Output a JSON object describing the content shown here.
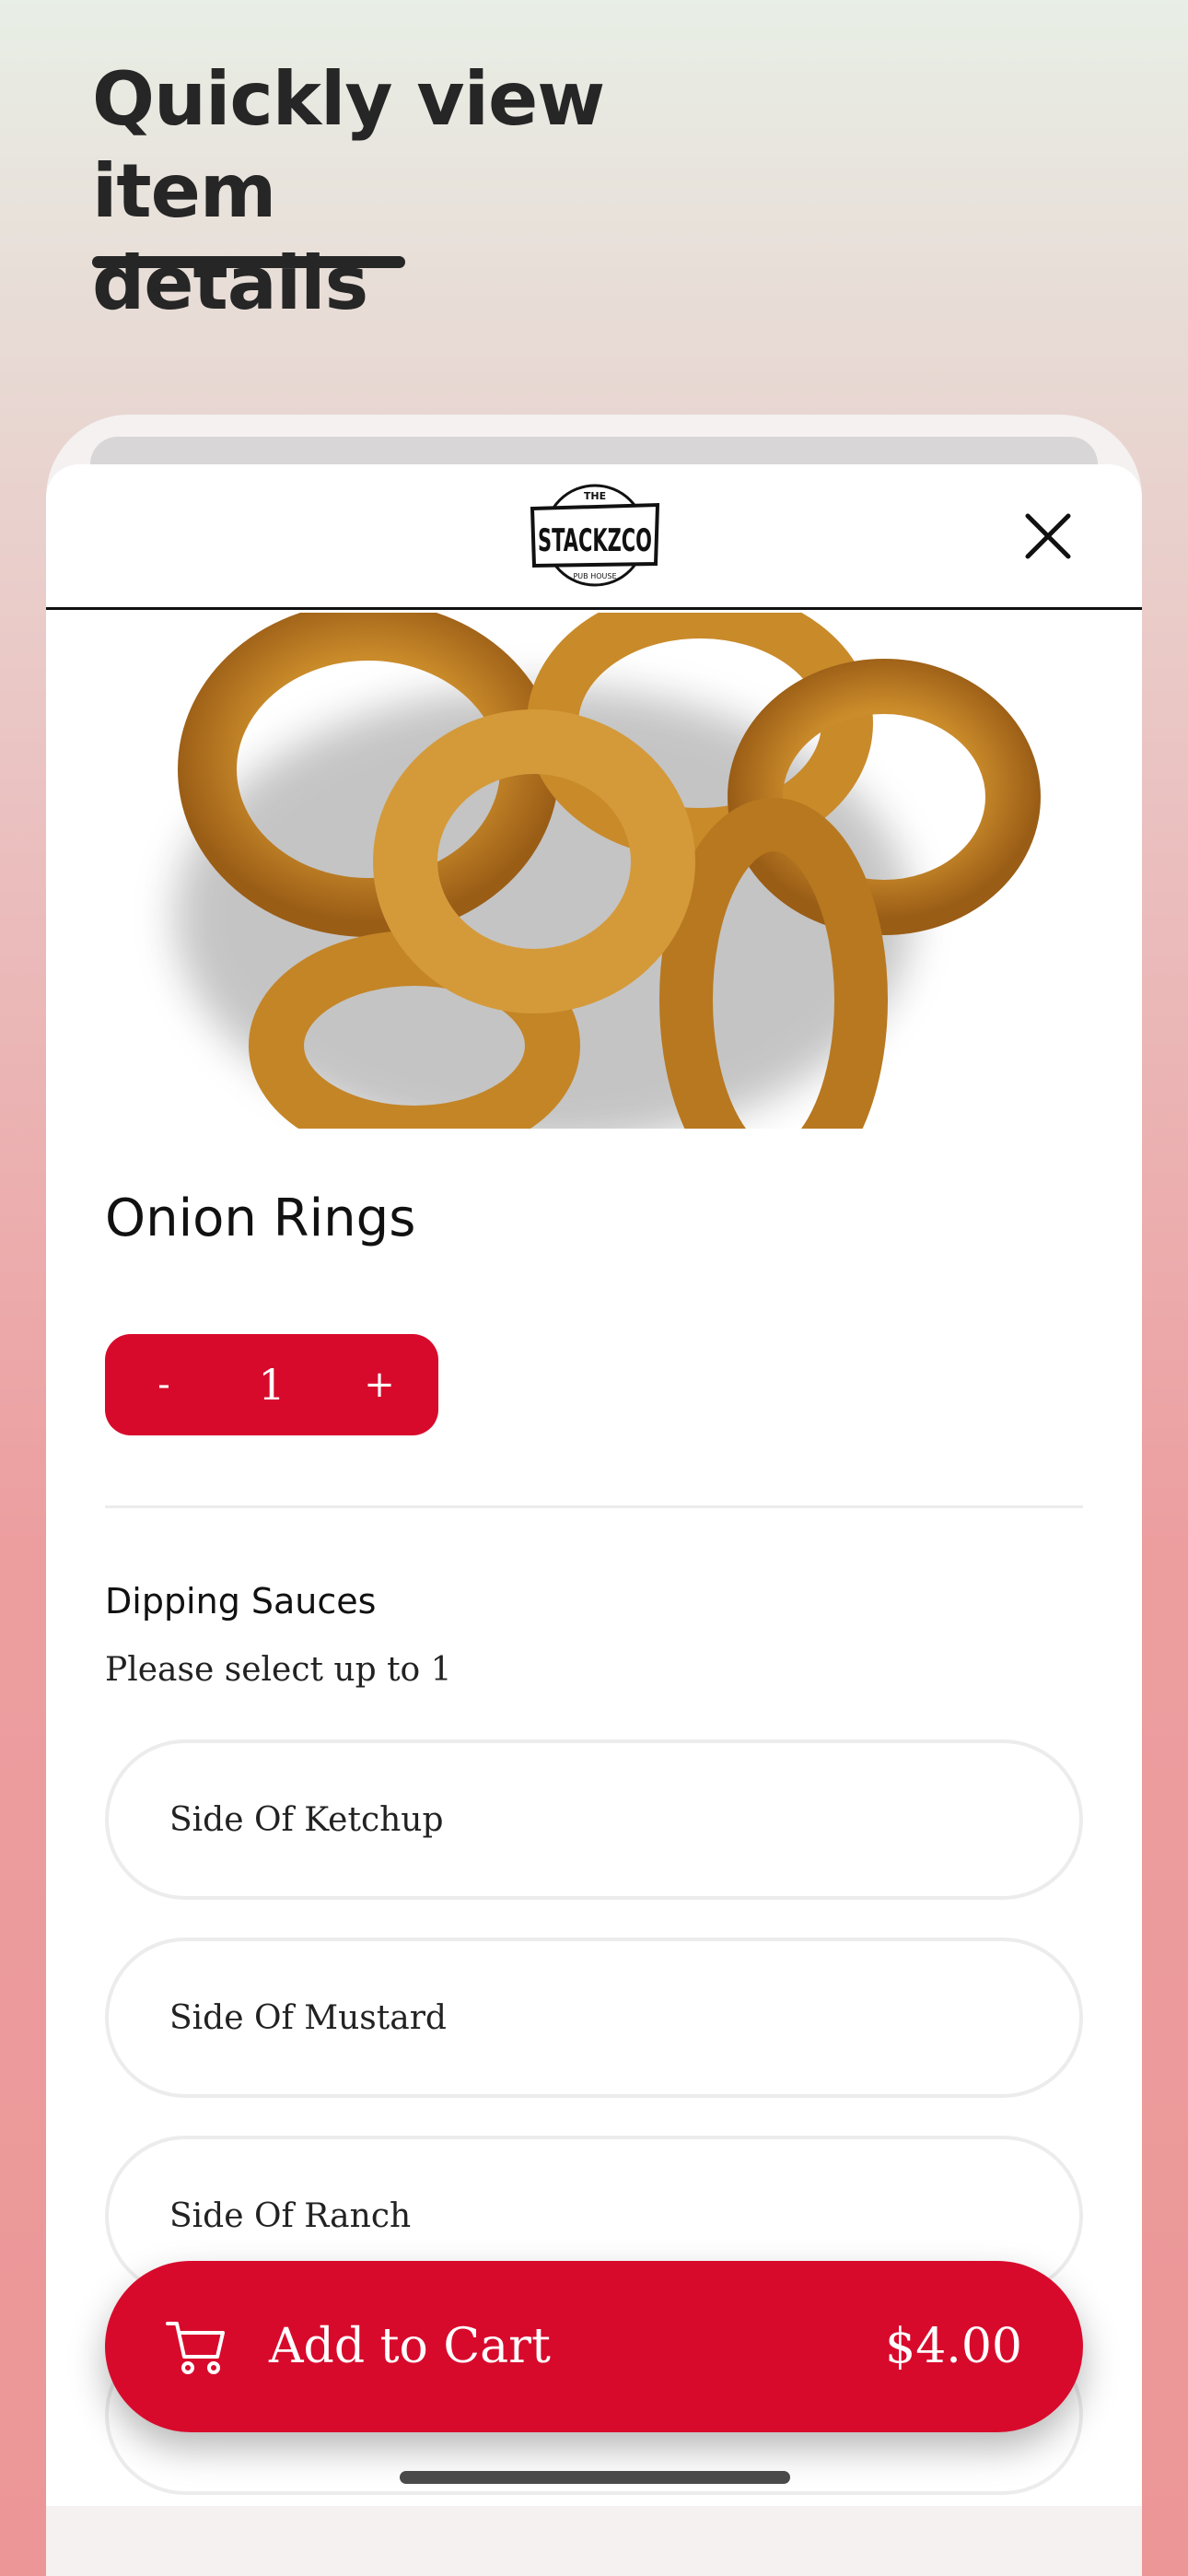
{
  "headline": {
    "line1": "Quickly view item",
    "line2": "details"
  },
  "header": {
    "logo": {
      "top_text": "THE",
      "brand": "STACKZCO",
      "bottom_text": "PUB HOUSE"
    },
    "close_icon": "close-icon"
  },
  "item": {
    "image_icon": "onion-rings-image",
    "name": "Onion Rings",
    "quantity": {
      "minus_label": "-",
      "value": "1",
      "plus_label": "+"
    }
  },
  "modifiers": {
    "title": "Dipping Sauces",
    "subtitle": "Please select up to 1",
    "options": [
      {
        "label": "Side Of Ketchup"
      },
      {
        "label": "Side Of Mustard"
      },
      {
        "label": "Side Of Ranch"
      },
      {
        "label": ""
      }
    ]
  },
  "cart": {
    "icon": "cart-icon",
    "label": "Add to Cart",
    "price": "$4.00"
  },
  "colors": {
    "accent": "#d80a2c",
    "text": "#111111",
    "headline": "#262626"
  }
}
